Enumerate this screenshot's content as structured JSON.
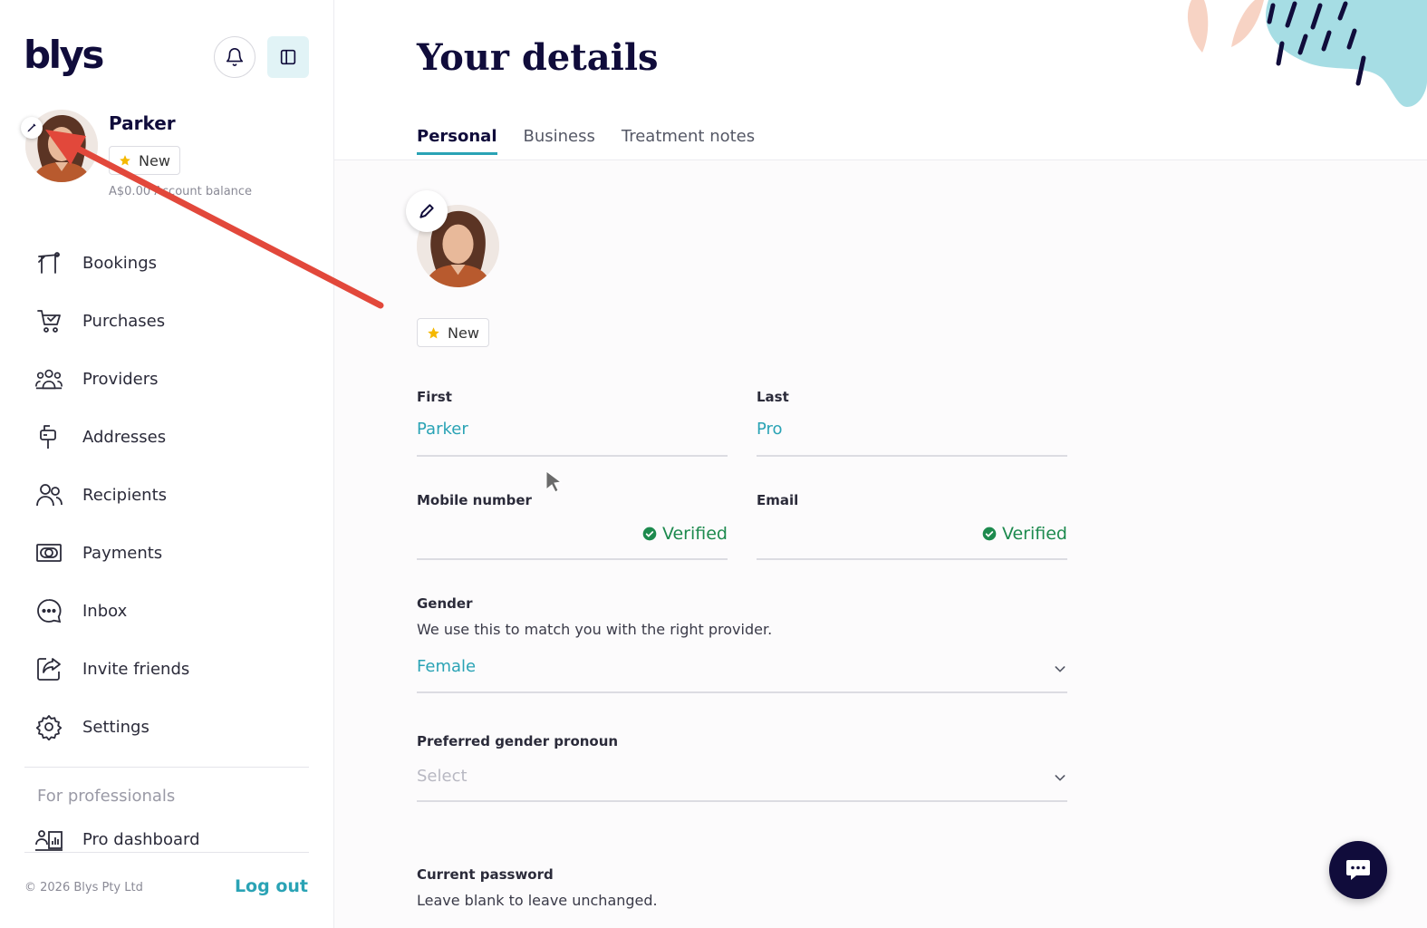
{
  "brand": {
    "logo_text": "blys"
  },
  "colors": {
    "accent": "#2aa3b5",
    "navy": "#100C3B",
    "verified": "#1d8a4e",
    "arrow": "#e2483b",
    "star": "#f5b800"
  },
  "profile": {
    "name": "Parker",
    "badge": "New",
    "balance": "A$0.00 Account balance"
  },
  "nav": {
    "items": [
      {
        "label": "Bookings",
        "icon": "bookings-icon"
      },
      {
        "label": "Purchases",
        "icon": "cart-icon"
      },
      {
        "label": "Providers",
        "icon": "providers-icon"
      },
      {
        "label": "Addresses",
        "icon": "mailbox-icon"
      },
      {
        "label": "Recipients",
        "icon": "recipients-icon"
      },
      {
        "label": "Payments",
        "icon": "payments-icon"
      },
      {
        "label": "Inbox",
        "icon": "chat-bubble-icon"
      },
      {
        "label": "Invite friends",
        "icon": "share-icon"
      },
      {
        "label": "Settings",
        "icon": "gear-icon"
      }
    ],
    "section_label": "For professionals",
    "pro_item": "Pro dashboard"
  },
  "footer": {
    "copyright": "© 2026 Blys Pty Ltd",
    "logout": "Log out"
  },
  "page": {
    "title": "Your details",
    "tabs": [
      {
        "label": "Personal",
        "active": true
      },
      {
        "label": "Business",
        "active": false
      },
      {
        "label": "Treatment notes",
        "active": false
      }
    ]
  },
  "form": {
    "badge": "New",
    "first": {
      "label": "First",
      "value": "Parker"
    },
    "last": {
      "label": "Last",
      "value": "Pro"
    },
    "mobile": {
      "label": "Mobile number",
      "status": "Verified"
    },
    "email": {
      "label": "Email",
      "status": "Verified"
    },
    "gender": {
      "label": "Gender",
      "help": "We use this to match you with the right provider.",
      "value": "Female"
    },
    "pronoun": {
      "label": "Preferred gender pronoun",
      "placeholder": "Select"
    },
    "password": {
      "label": "Current password",
      "help": "Leave blank to leave unchanged."
    }
  }
}
